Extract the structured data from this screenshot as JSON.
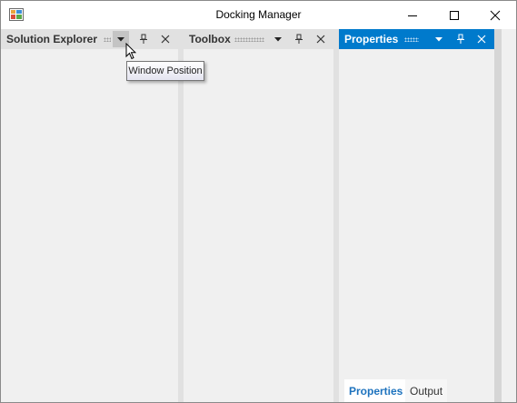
{
  "window": {
    "title": "Docking Manager",
    "icon": "app-window-icon",
    "controls": {
      "minimize": "minimize-icon",
      "maximize": "maximize-icon",
      "close": "close-icon"
    }
  },
  "panes": {
    "solution_explorer": {
      "title": "Solution Explorer",
      "active": false
    },
    "toolbox": {
      "title": "Toolbox",
      "active": false
    },
    "properties": {
      "title": "Properties",
      "active": true
    }
  },
  "bottom_tabs": [
    {
      "label": "Properties",
      "selected": true
    },
    {
      "label": "Output",
      "selected": false
    }
  ],
  "tooltip": {
    "text": "Window Position"
  },
  "colors": {
    "accent": "#007acc",
    "inactive_header": "#e1e1e1",
    "selected_tab_text": "#1e73be"
  }
}
